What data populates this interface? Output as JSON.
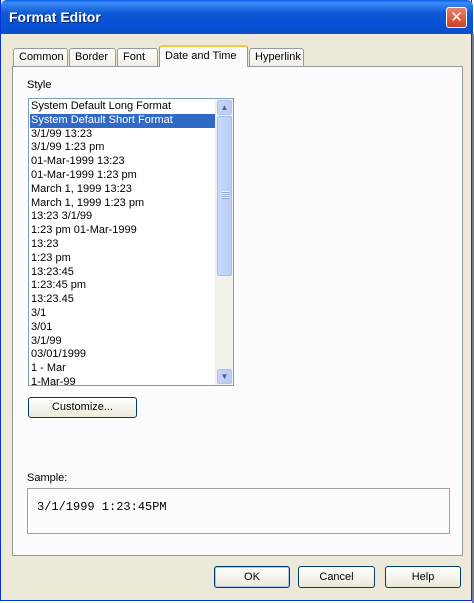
{
  "window": {
    "title": "Format Editor",
    "close_icon": "close-icon"
  },
  "tabs": [
    {
      "label": "Common",
      "active": false
    },
    {
      "label": "Border",
      "active": false
    },
    {
      "label": "Font",
      "active": false
    },
    {
      "label": "Date and Time",
      "active": true
    },
    {
      "label": "Hyperlink",
      "active": false
    }
  ],
  "style": {
    "label": "Style",
    "selected_index": 1,
    "items": [
      "System Default Long Format",
      "System Default Short Format",
      "3/1/99  13:23",
      "3/1/99  1:23 pm",
      "01-Mar-1999  13:23",
      "01-Mar-1999  1:23 pm",
      "March 1, 1999  13:23",
      "March 1, 1999  1:23 pm",
      "13:23  3/1/99",
      "1:23 pm  01-Mar-1999",
      "13:23",
      "1:23 pm",
      "13:23:45",
      "1:23:45 pm",
      "13:23.45",
      "3/1",
      "3/01",
      "3/1/99",
      "03/01/1999",
      "1 - Mar",
      "1-Mar-99"
    ]
  },
  "customize_button": "Customize...",
  "sample": {
    "label": "Sample:",
    "value": "3/1/1999  1:23:45PM"
  },
  "buttons": {
    "ok": "OK",
    "cancel": "Cancel",
    "help": "Help"
  },
  "colors": {
    "title_bar": "#0a5ce8",
    "selection": "#316ac5",
    "dialog_bg": "#ece9d8",
    "active_tab_accent": "#ffc73c"
  }
}
